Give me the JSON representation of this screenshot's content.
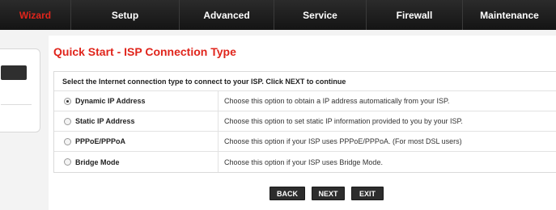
{
  "nav": {
    "tabs": [
      {
        "label": "Wizard",
        "active": true
      },
      {
        "label": "Setup",
        "active": false
      },
      {
        "label": "Advanced",
        "active": false
      },
      {
        "label": "Service",
        "active": false
      },
      {
        "label": "Firewall",
        "active": false
      },
      {
        "label": "Maintenance",
        "active": false
      }
    ]
  },
  "page": {
    "title": "Quick Start - ISP Connection Type",
    "instruction": "Select the Internet connection type to connect to your ISP. Click NEXT to continue"
  },
  "options": [
    {
      "label": "Dynamic IP Address",
      "description": "Choose this option to obtain a IP address automatically from your ISP.",
      "selected": true
    },
    {
      "label": "Static IP Address",
      "description": "Choose this option to set static IP information provided to you by your ISP.",
      "selected": false
    },
    {
      "label": "PPPoE/PPPoA",
      "description": "Choose this option if your ISP uses PPPoE/PPPoA. (For most DSL users)",
      "selected": false
    },
    {
      "label": "Bridge Mode",
      "description": "Choose this option if your ISP uses Bridge Mode.",
      "selected": false
    }
  ],
  "buttons": {
    "back": "BACK",
    "next": "NEXT",
    "exit": "EXIT"
  },
  "colors": {
    "accent": "#e0251c",
    "nav_background": "#1e1e1e",
    "button_background": "#2d2d2d"
  }
}
